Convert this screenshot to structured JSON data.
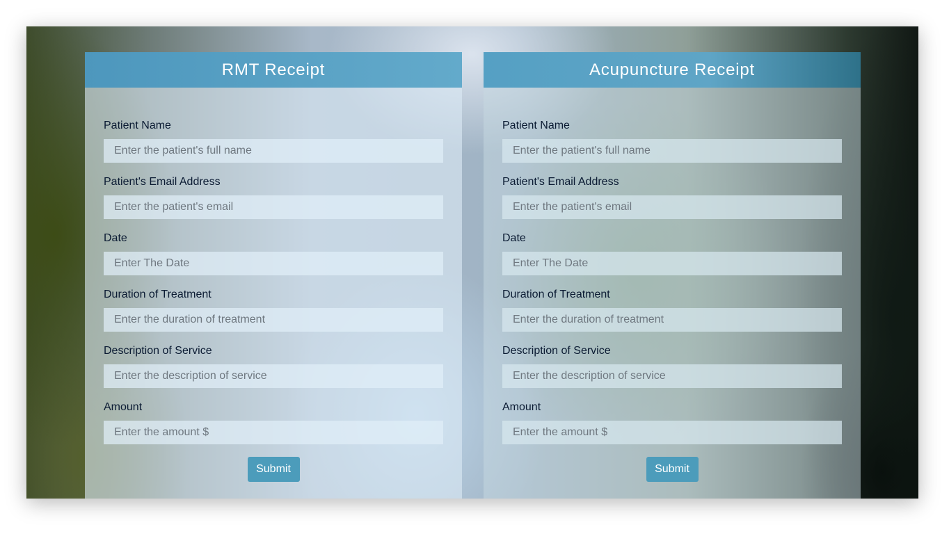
{
  "forms": [
    {
      "title": "RMT Receipt",
      "fields": [
        {
          "label": "Patient Name",
          "placeholder": "Enter the patient's full name"
        },
        {
          "label": "Patient's Email Address",
          "placeholder": "Enter the patient's email"
        },
        {
          "label": "Date",
          "placeholder": "Enter The Date"
        },
        {
          "label": "Duration of Treatment",
          "placeholder": "Enter the duration of treatment"
        },
        {
          "label": "Description of Service",
          "placeholder": "Enter the description of service"
        },
        {
          "label": "Amount",
          "placeholder": "Enter the amount $"
        }
      ],
      "submit_label": "Submit"
    },
    {
      "title": "Acupuncture Receipt",
      "fields": [
        {
          "label": "Patient Name",
          "placeholder": "Enter the patient's full name"
        },
        {
          "label": "Patient's Email Address",
          "placeholder": "Enter the patient's email"
        },
        {
          "label": "Date",
          "placeholder": "Enter The Date"
        },
        {
          "label": "Duration of Treatment",
          "placeholder": "Enter the duration of treatment"
        },
        {
          "label": "Description of Service",
          "placeholder": "Enter the description of service"
        },
        {
          "label": "Amount",
          "placeholder": "Enter the amount $"
        }
      ],
      "submit_label": "Submit"
    }
  ],
  "colors": {
    "header_accent": "#4d97bd",
    "button": "#4c9cbb",
    "label_text": "#0b1b33"
  }
}
